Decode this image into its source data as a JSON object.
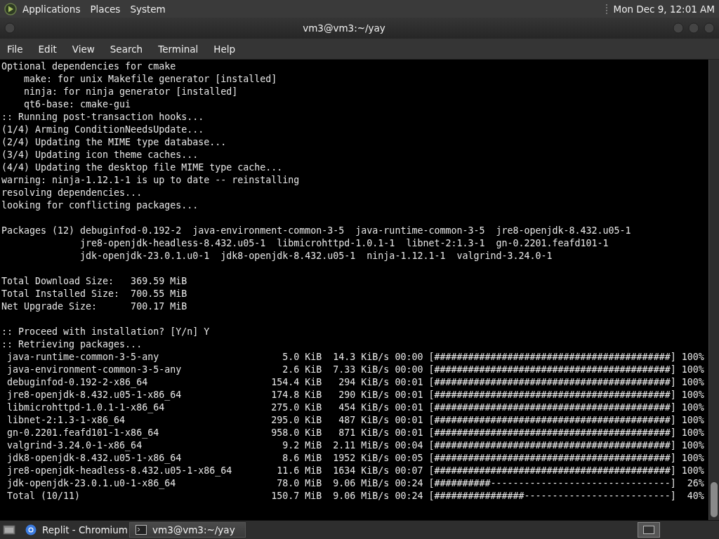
{
  "top_panel": {
    "menus": [
      "Applications",
      "Places",
      "System"
    ],
    "clock": "Mon Dec 9, 12:01 AM"
  },
  "window": {
    "title": "vm3@vm3:~/yay"
  },
  "menu_bar": [
    "File",
    "Edit",
    "View",
    "Search",
    "Terminal",
    "Help"
  ],
  "terminal": {
    "blocks": [
      {
        "lines": [
          "Optional dependencies for cmake",
          "    make: for unix Makefile generator [installed]",
          "    ninja: for ninja generator [installed]",
          "    qt6-base: cmake-gui",
          ":: Running post-transaction hooks...",
          "(1/4) Arming ConditionNeedsUpdate...",
          "(2/4) Updating the MIME type database...",
          "(3/4) Updating icon theme caches...",
          "(4/4) Updating the desktop file MIME type cache...",
          "warning: ninja-1.12.1-1 is up to date -- reinstalling",
          "resolving dependencies...",
          "looking for conflicting packages..."
        ]
      },
      {
        "lines": [
          "Packages (12) debuginfod-0.192-2  java-environment-common-3-5  java-runtime-common-3-5  jre8-openjdk-8.432.u05-1",
          "              jre8-openjdk-headless-8.432.u05-1  libmicrohttpd-1.0.1-1  libnet-2:1.3-1  gn-0.2201.feafd101-1",
          "              jdk-openjdk-23.0.1.u0-1  jdk8-openjdk-8.432.u05-1  ninja-1.12.1-1  valgrind-3.24.0-1"
        ]
      },
      {
        "lines": [
          "Total Download Size:   369.59 MiB",
          "Total Installed Size:  700.55 MiB",
          "Net Upgrade Size:      700.17 MiB"
        ]
      },
      {
        "lines": [
          ":: Proceed with installation? [Y/n] Y",
          ":: Retrieving packages..."
        ]
      }
    ],
    "downloads": [
      {
        "name": "java-runtime-common-3-5-any",
        "size": "5.0 KiB",
        "rate": "14.3 KiB/s",
        "time": "00:00",
        "bar": "[##########################################]",
        "percent": "100%"
      },
      {
        "name": "java-environment-common-3-5-any",
        "size": "2.6 KiB",
        "rate": "7.33 KiB/s",
        "time": "00:00",
        "bar": "[##########################################]",
        "percent": "100%"
      },
      {
        "name": "debuginfod-0.192-2-x86_64",
        "size": "154.4 KiB",
        "rate": "294 KiB/s",
        "time": "00:01",
        "bar": "[##########################################]",
        "percent": "100%"
      },
      {
        "name": "jre8-openjdk-8.432.u05-1-x86_64",
        "size": "174.8 KiB",
        "rate": "290 KiB/s",
        "time": "00:01",
        "bar": "[##########################################]",
        "percent": "100%"
      },
      {
        "name": "libmicrohttpd-1.0.1-1-x86_64",
        "size": "275.0 KiB",
        "rate": "454 KiB/s",
        "time": "00:01",
        "bar": "[##########################################]",
        "percent": "100%"
      },
      {
        "name": "libnet-2:1.3-1-x86_64",
        "size": "295.0 KiB",
        "rate": "487 KiB/s",
        "time": "00:01",
        "bar": "[##########################################]",
        "percent": "100%"
      },
      {
        "name": "gn-0.2201.feafd101-1-x86_64",
        "size": "958.0 KiB",
        "rate": "871 KiB/s",
        "time": "00:01",
        "bar": "[##########################################]",
        "percent": "100%"
      },
      {
        "name": "valgrind-3.24.0-1-x86_64",
        "size": "9.2 MiB",
        "rate": "2.11 MiB/s",
        "time": "00:04",
        "bar": "[##########################################]",
        "percent": "100%"
      },
      {
        "name": "jdk8-openjdk-8.432.u05-1-x86_64",
        "size": "8.6 MiB",
        "rate": "1952 KiB/s",
        "time": "00:05",
        "bar": "[##########################################]",
        "percent": "100%"
      },
      {
        "name": "jre8-openjdk-headless-8.432.u05-1-x86_64",
        "size": "11.6 MiB",
        "rate": "1634 KiB/s",
        "time": "00:07",
        "bar": "[##########################################]",
        "percent": "100%"
      },
      {
        "name": "jdk-openjdk-23.0.1.u0-1-x86_64",
        "size": "78.0 MiB",
        "rate": "9.06 MiB/s",
        "time": "00:24",
        "bar": "[##########--------------------------------]",
        "percent": "26%"
      },
      {
        "name": "Total (10/11)",
        "size": "150.7 MiB",
        "rate": "9.06 MiB/s",
        "time": "00:24",
        "bar": "[################--------------------------]",
        "percent": "40%"
      }
    ]
  },
  "taskbar": {
    "tasks": [
      {
        "label": "Replit - Chromium",
        "kind": "browser",
        "selected": false
      },
      {
        "label": "vm3@vm3:~/yay",
        "kind": "terminal",
        "selected": true
      }
    ]
  }
}
